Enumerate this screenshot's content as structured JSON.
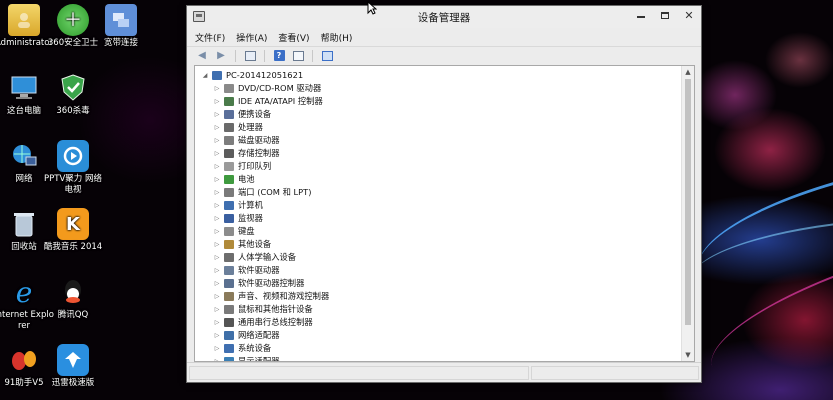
{
  "window": {
    "title": "设备管理器",
    "menu": [
      "文件(F)",
      "操作(A)",
      "查看(V)",
      "帮助(H)"
    ],
    "toolbar_icons": [
      "back-arrow-icon",
      "forward-arrow-icon",
      "show-hide-tree-icon",
      "help-icon",
      "properties-icon",
      "scan-hardware-icon"
    ],
    "root": "PC-201412051621",
    "devices": [
      {
        "label": "DVD/CD-ROM 驱动器",
        "icon": "dvd-drive-icon",
        "color": "#8a8a8a"
      },
      {
        "label": "IDE ATA/ATAPI 控制器",
        "icon": "ide-controller-icon",
        "color": "#4a7b4a"
      },
      {
        "label": "便携设备",
        "icon": "portable-device-icon",
        "color": "#5a6f9a"
      },
      {
        "label": "处理器",
        "icon": "processor-icon",
        "color": "#6a6a6a"
      },
      {
        "label": "磁盘驱动器",
        "icon": "disk-drive-icon",
        "color": "#7d7d7d"
      },
      {
        "label": "存储控制器",
        "icon": "storage-controller-icon",
        "color": "#5c5c5c"
      },
      {
        "label": "打印队列",
        "icon": "printer-icon",
        "color": "#9a9a9a"
      },
      {
        "label": "电池",
        "icon": "battery-icon",
        "color": "#3f9a3f"
      },
      {
        "label": "端口 (COM 和 LPT)",
        "icon": "port-icon",
        "color": "#7a7a7a"
      },
      {
        "label": "计算机",
        "icon": "computer-icon",
        "color": "#3f6fb0"
      },
      {
        "label": "监视器",
        "icon": "monitor-icon",
        "color": "#3a5fa0"
      },
      {
        "label": "键盘",
        "icon": "keyboard-icon",
        "color": "#8c8c8c"
      },
      {
        "label": "其他设备",
        "icon": "other-device-icon",
        "color": "#b08a3a"
      },
      {
        "label": "人体学输入设备",
        "icon": "hid-icon",
        "color": "#6d6d6d"
      },
      {
        "label": "软件驱动器",
        "icon": "software-device-icon",
        "color": "#6b7f9a"
      },
      {
        "label": "软件驱动器控制器",
        "icon": "software-controller-icon",
        "color": "#5a7090"
      },
      {
        "label": "声音、视频和游戏控制器",
        "icon": "sound-icon",
        "color": "#8a7a5a"
      },
      {
        "label": "鼠标和其他指针设备",
        "icon": "mouse-icon",
        "color": "#7a7a7a"
      },
      {
        "label": "通用串行总线控制器",
        "icon": "usb-icon",
        "color": "#555555"
      },
      {
        "label": "网络适配器",
        "icon": "network-adapter-icon",
        "color": "#3f6fa8"
      },
      {
        "label": "系统设备",
        "icon": "system-device-icon",
        "color": "#3f6fb0"
      },
      {
        "label": "显示适配器",
        "icon": "display-adapter-icon",
        "color": "#3a7fb5"
      }
    ]
  },
  "desktop": {
    "icons": [
      {
        "label": "Administrator",
        "icon": "user-folder-icon",
        "color": "#e8c24a"
      },
      {
        "label": "360安全卫士",
        "icon": "360-safe-icon",
        "color": "#3fae3a"
      },
      {
        "label": "宽带连接",
        "icon": "broadband-icon",
        "color": "#4a79c8"
      },
      {
        "label": "这台电脑",
        "icon": "this-pc-icon",
        "color": "#3a8fd0"
      },
      {
        "label": "360杀毒",
        "icon": "360-antivirus-icon",
        "color": "#3aa44a"
      },
      {
        "label": "网络",
        "icon": "network-icon",
        "color": "#2f8fd8"
      },
      {
        "label": "PPTV聚力 网络电视",
        "icon": "pptv-icon",
        "color": "#2a8ed8"
      },
      {
        "label": "回收站",
        "icon": "recycle-bin-icon",
        "color": "#9ab0c4"
      },
      {
        "label": "酷我音乐 2014",
        "icon": "kuwo-music-icon",
        "color": "#f39a1c"
      },
      {
        "label": "Internet Explorer",
        "icon": "ie-icon",
        "color": "#2a7fd4"
      },
      {
        "label": "腾讯QQ",
        "icon": "qq-icon",
        "color": "#222222"
      },
      {
        "label": "91助手V5",
        "icon": "91-assistant-icon",
        "color": "#d8342c"
      },
      {
        "label": "迅雷极速版",
        "icon": "xunlei-icon",
        "color": "#2a8fe0"
      }
    ]
  }
}
